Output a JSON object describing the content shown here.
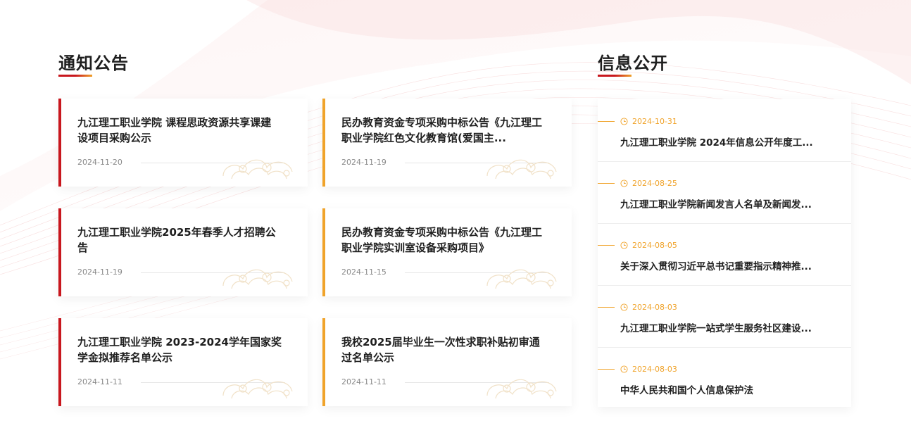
{
  "notices": {
    "heading": "通知公告",
    "cards": [
      {
        "title": "九江理工职业学院 课程思政资源共享课建设项目采购公示",
        "date": "2024-11-20"
      },
      {
        "title": "民办教育资金专项采购中标公告《九江理工职业学院红色文化教育馆(爱国主...",
        "date": "2024-11-19"
      },
      {
        "title": "九江理工职业学院2025年春季人才招聘公告",
        "date": "2024-11-19"
      },
      {
        "title": "民办教育资金专项采购中标公告《九江理工职业学院实训室设备采购项目》",
        "date": "2024-11-15"
      },
      {
        "title": "九江理工职业学院 2023-2024学年国家奖学金拟推荐名单公示",
        "date": "2024-11-11"
      },
      {
        "title": "我校2025届毕业生一次性求职补贴初审通过名单公示",
        "date": "2024-11-11"
      }
    ]
  },
  "info_disclosure": {
    "heading": "信息公开",
    "items": [
      {
        "date": "2024-10-31",
        "title": "九江理工职业学院 2024年信息公开年度工..."
      },
      {
        "date": "2024-08-25",
        "title": "九江理工职业学院新闻发言人名单及新闻发..."
      },
      {
        "date": "2024-08-05",
        "title": "关于深入贯彻习近平总书记重要指示精神推..."
      },
      {
        "date": "2024-08-03",
        "title": "九江理工职业学院一站式学生服务社区建设..."
      },
      {
        "date": "2024-08-03",
        "title": "中华人民共和国个人信息保护法"
      }
    ]
  },
  "colors": {
    "accent_red": "#c8171e",
    "accent_orange": "#f0a32a"
  },
  "icons": {
    "date_icon": "clock-icon",
    "card_decoration": "auspicious-cloud-pattern"
  }
}
